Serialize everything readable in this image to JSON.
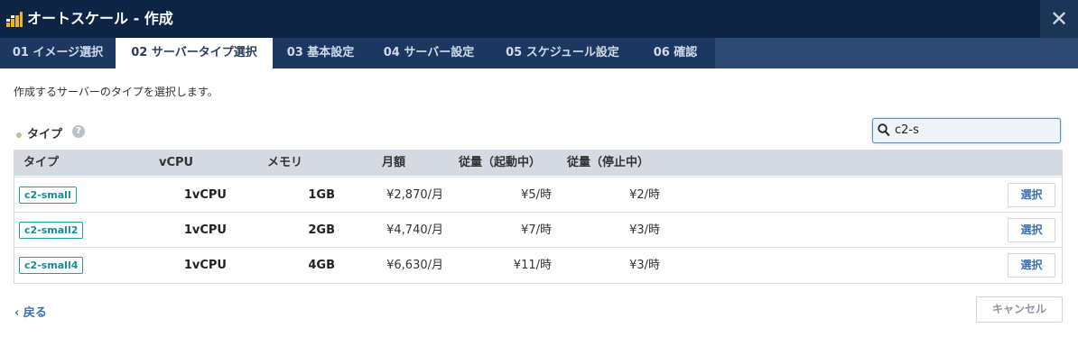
{
  "window": {
    "title": "オートスケール - 作成",
    "close_icon": "close-icon",
    "logo_icon": "bar-chart-logo-icon"
  },
  "tabs": [
    {
      "label": "01 イメージ選択",
      "active": false
    },
    {
      "label": "02 サーバータイプ選択",
      "active": true
    },
    {
      "label": "03 基本設定",
      "active": false
    },
    {
      "label": "04 サーバー設定",
      "active": false
    },
    {
      "label": "05 スケジュール設定",
      "active": false
    },
    {
      "label": "06 確認",
      "active": false
    }
  ],
  "description": "作成するサーバーのタイプを選択します。",
  "section": {
    "label": "タイプ",
    "help_icon": "question-icon"
  },
  "search": {
    "value": "c2-s",
    "icon": "search-icon"
  },
  "table": {
    "headers": [
      "タイプ",
      "vCPU",
      "メモリ",
      "月額",
      "従量（起動中）",
      "従量（停止中）"
    ],
    "rows": [
      {
        "type": "c2-small",
        "vcpu": "1vCPU",
        "memory": "1GB",
        "monthly": "¥2,870/月",
        "running": "¥5/時",
        "stopped": "¥2/時",
        "action": "選択"
      },
      {
        "type": "c2-small2",
        "vcpu": "1vCPU",
        "memory": "2GB",
        "monthly": "¥4,740/月",
        "running": "¥7/時",
        "stopped": "¥3/時",
        "action": "選択"
      },
      {
        "type": "c2-small4",
        "vcpu": "1vCPU",
        "memory": "4GB",
        "monthly": "¥6,630/月",
        "running": "¥11/時",
        "stopped": "¥3/時",
        "action": "選択"
      }
    ]
  },
  "footer": {
    "back_label": "戻る",
    "cancel_label": "キャンセル"
  },
  "colors": {
    "titlebar": "#0d2444",
    "tabbar": "#2c4a72",
    "tag": "#1aa0a8",
    "accent": "#3a6fb0"
  }
}
